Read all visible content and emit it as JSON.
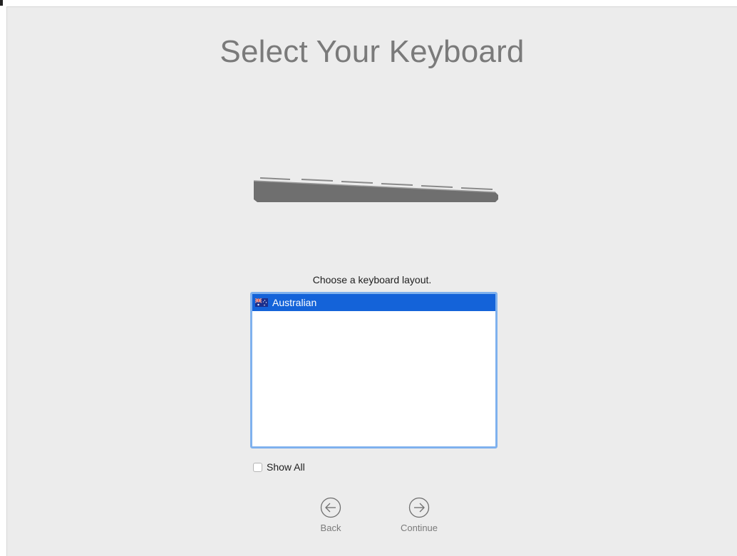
{
  "header": {
    "title": "Select Your Keyboard"
  },
  "main": {
    "prompt": "Choose a keyboard layout.",
    "layouts": [
      {
        "label": "Australian",
        "icon": "australia-flag-icon",
        "selected": true
      }
    ],
    "show_all_label": "Show All",
    "show_all_checked": false
  },
  "footer": {
    "back_label": "Back",
    "continue_label": "Continue"
  },
  "colors": {
    "window_bg": "#ececec",
    "selection": "#1463d9",
    "focus_ring": "#7fb1ee",
    "title_text": "#7a7a7a"
  }
}
